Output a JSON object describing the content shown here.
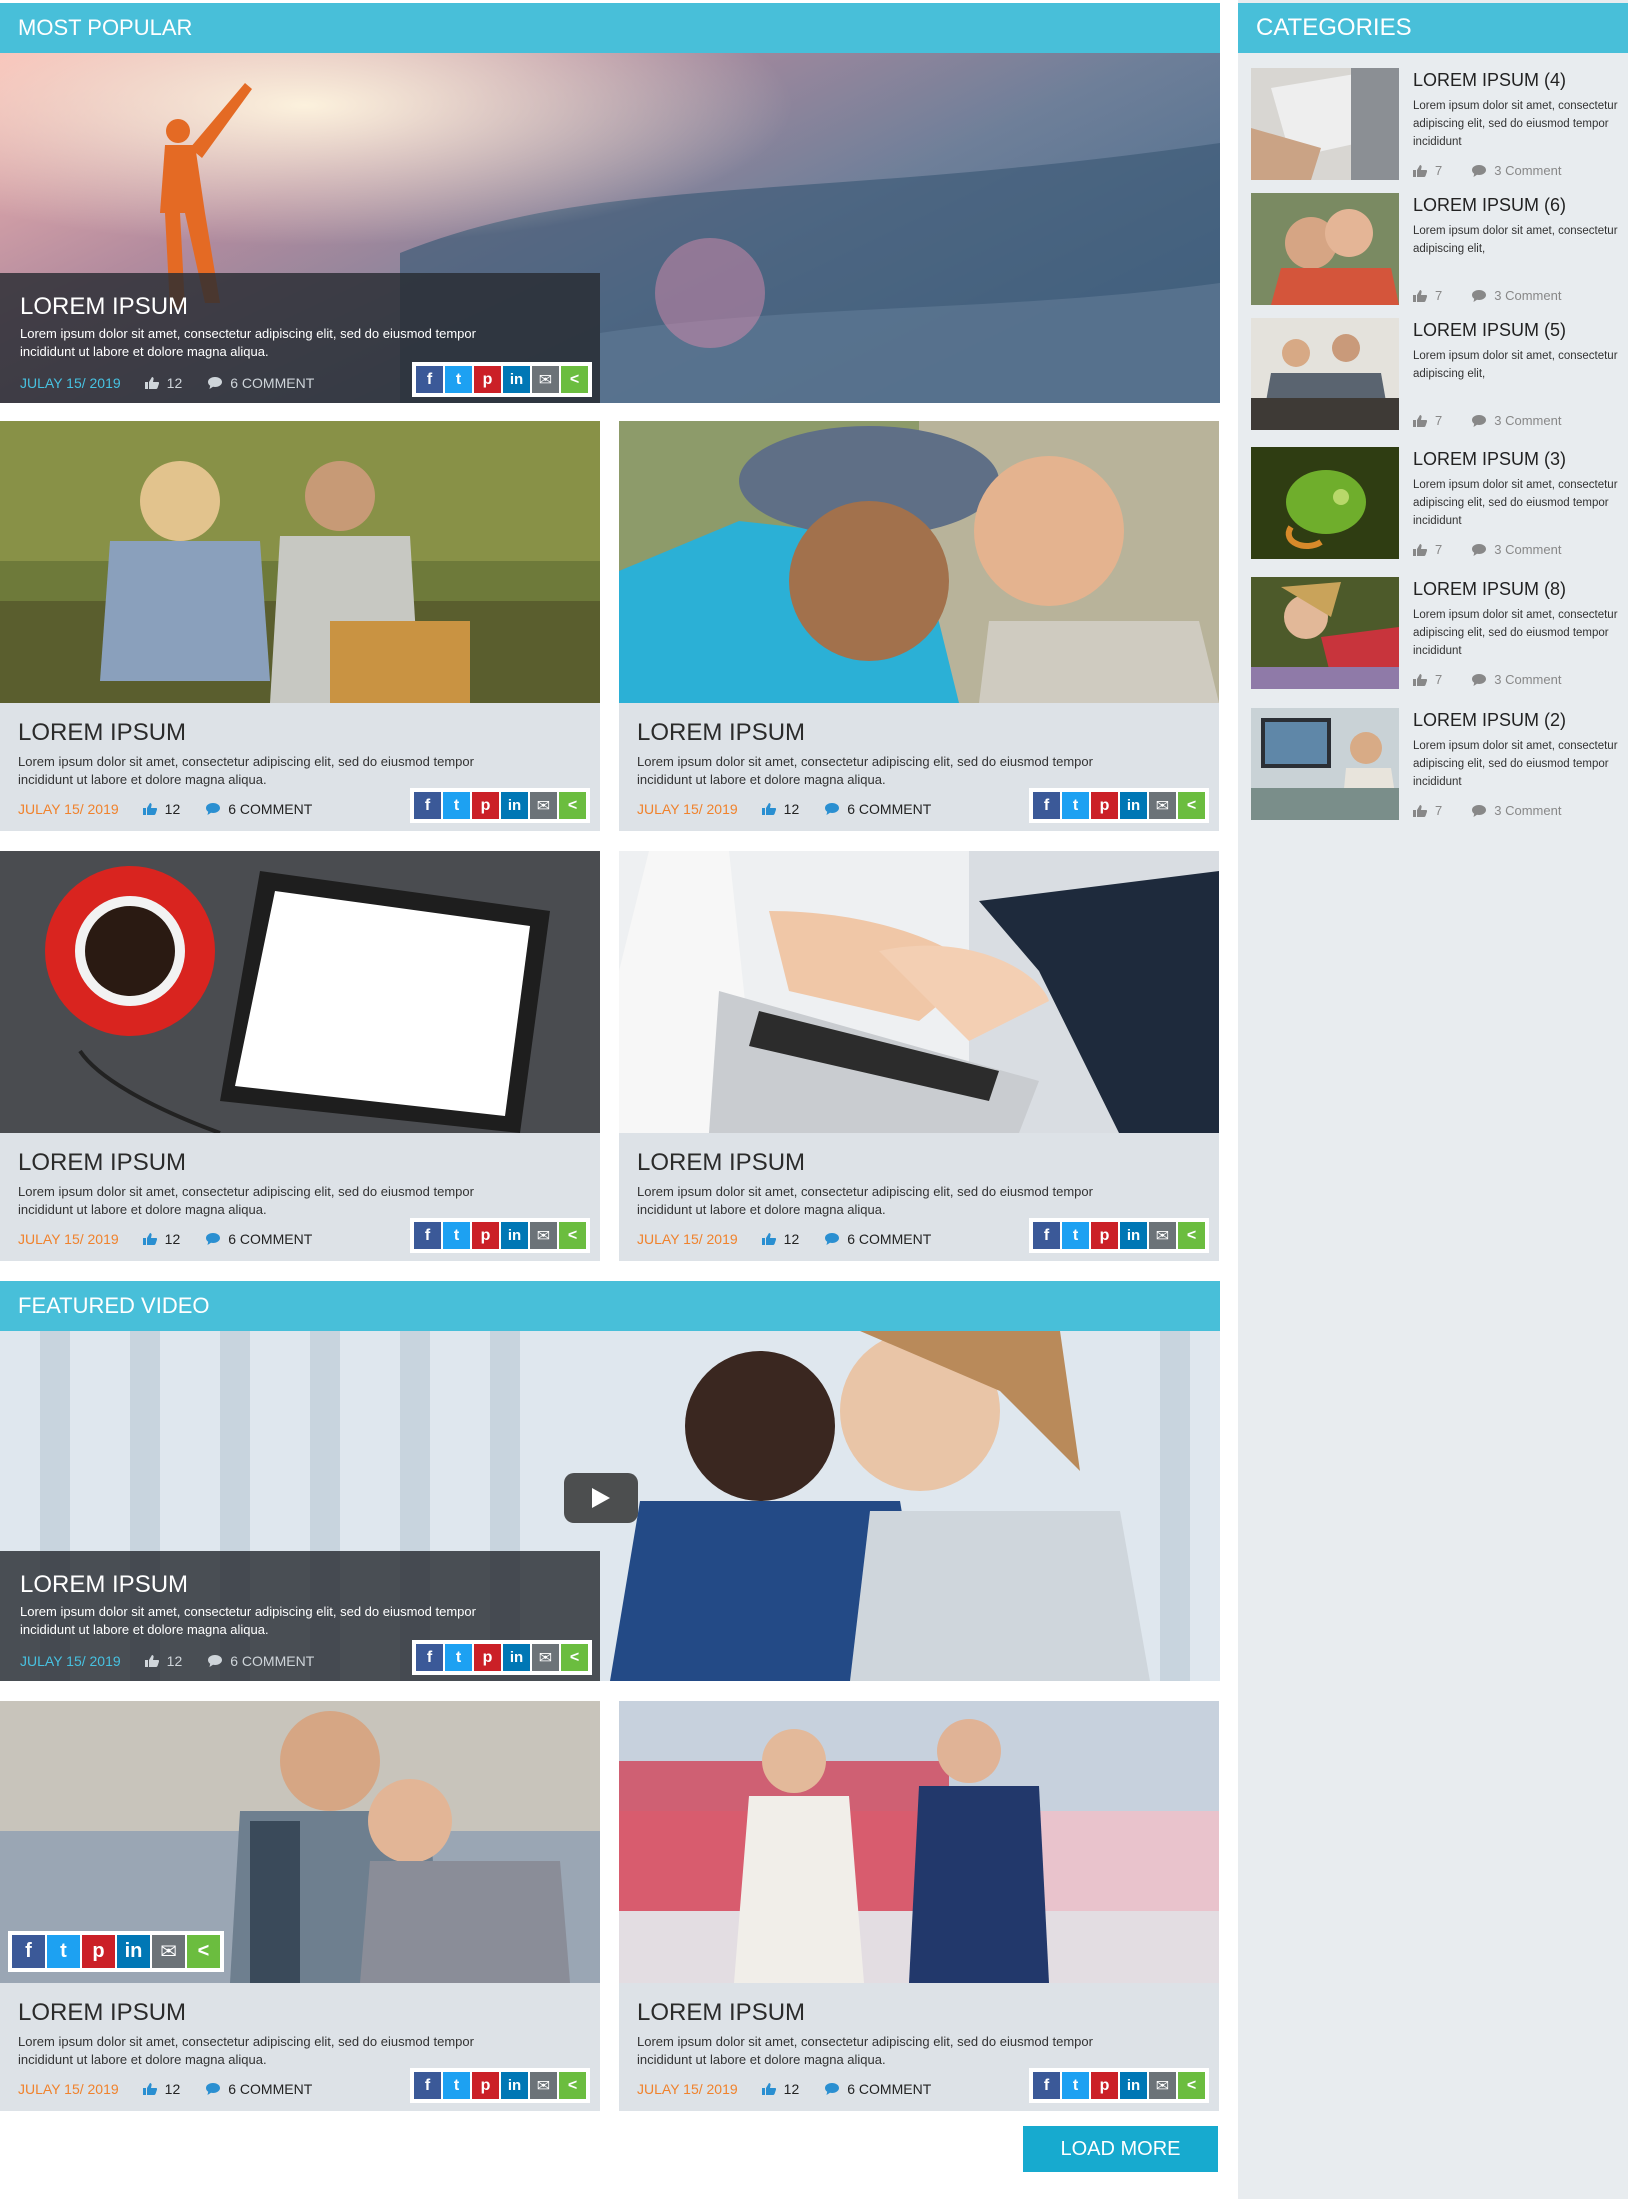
{
  "sections": {
    "most_popular": "MOST POPULAR",
    "featured_video": "FEATURED VIDEO",
    "categories": "CATEGORIES"
  },
  "hero_popular": {
    "title": "LOREM IPSUM",
    "desc": "Lorem ipsum dolor sit amet, consectetur adipiscing elit, sed do eiusmod tempor incididunt ut labore et dolore magna aliqua.",
    "date": "JULAY 15/ 2019",
    "likes": "12",
    "comments": "6  COMMENT"
  },
  "hero_video": {
    "title": "LOREM IPSUM",
    "desc": "Lorem ipsum dolor sit amet, consectetur adipiscing elit, sed do eiusmod tempor incididunt ut labore et dolore magna aliqua.",
    "date": "JULAY 15/ 2019",
    "likes": "12",
    "comments": "6  COMMENT"
  },
  "cards": [
    {
      "title": "LOREM IPSUM",
      "desc": "Lorem ipsum dolor sit amet, consectetur adipiscing elit, sed do eiusmod tempor incididunt ut labore et dolore magna aliqua.",
      "date": "JULAY 15/ 2019",
      "likes": "12",
      "comments": "6  COMMENT"
    },
    {
      "title": "LOREM IPSUM",
      "desc": "Lorem ipsum dolor sit amet, consectetur adipiscing elit, sed do eiusmod tempor incididunt ut labore et dolore magna aliqua.",
      "date": "JULAY 15/ 2019",
      "likes": "12",
      "comments": "6  COMMENT"
    },
    {
      "title": "LOREM IPSUM",
      "desc": "Lorem ipsum dolor sit amet, consectetur adipiscing elit, sed do eiusmod tempor incididunt ut labore et dolore magna aliqua.",
      "date": "JULAY 15/ 2019",
      "likes": "12",
      "comments": "6  COMMENT"
    },
    {
      "title": "LOREM IPSUM",
      "desc": "Lorem ipsum dolor sit amet, consectetur adipiscing elit, sed do eiusmod tempor incididunt ut labore et dolore magna aliqua.",
      "date": "JULAY 15/ 2019",
      "likes": "12",
      "comments": "6  COMMENT"
    },
    {
      "title": "LOREM IPSUM",
      "desc": "Lorem ipsum dolor sit amet, consectetur adipiscing elit, sed do eiusmod tempor incididunt ut labore et dolore magna aliqua.",
      "date": "JULAY 15/ 2019",
      "likes": "12",
      "comments": "6  COMMENT"
    },
    {
      "title": "LOREM IPSUM",
      "desc": "Lorem ipsum dolor sit amet, consectetur adipiscing elit, sed do eiusmod tempor incididunt ut labore et dolore magna aliqua.",
      "date": "JULAY 15/ 2019",
      "likes": "12",
      "comments": "6  COMMENT"
    }
  ],
  "share": {
    "fb": "f",
    "tw": "t",
    "pi": "p",
    "li": "in",
    "em": "✉",
    "sh": "<"
  },
  "categories": [
    {
      "title": "LOREM IPSUM (4)",
      "desc": "Lorem ipsum dolor sit amet, consectetur adipiscing elit, sed do eiusmod tempor incididunt",
      "likes": "7",
      "comments": "3  Comment"
    },
    {
      "title": "LOREM IPSUM (6)",
      "desc": "Lorem ipsum dolor sit amet, consectetur adipiscing elit,",
      "likes": "7",
      "comments": "3  Comment"
    },
    {
      "title": "LOREM IPSUM (5)",
      "desc": "Lorem ipsum dolor sit amet, consectetur adipiscing elit,",
      "likes": "7",
      "comments": "3  Comment"
    },
    {
      "title": "LOREM IPSUM (3)",
      "desc": "Lorem ipsum dolor sit amet, consectetur adipiscing elit, sed do eiusmod tempor incididunt",
      "likes": "7",
      "comments": "3  Comment"
    },
    {
      "title": "LOREM IPSUM (8)",
      "desc": "Lorem ipsum dolor sit amet, consectetur adipiscing elit, sed do eiusmod tempor incididunt",
      "likes": "7",
      "comments": "3  Comment"
    },
    {
      "title": "LOREM IPSUM (2)",
      "desc": "Lorem ipsum dolor sit amet, consectetur adipiscing elit, sed do eiusmod tempor incididunt",
      "likes": "7",
      "comments": "3  Comment"
    }
  ],
  "load_more": "LOAD MORE",
  "colors": {
    "accent": "#48bfd9",
    "date_orange": "#f0822c",
    "date_blue": "#47c1e0",
    "button": "#17aacf"
  }
}
